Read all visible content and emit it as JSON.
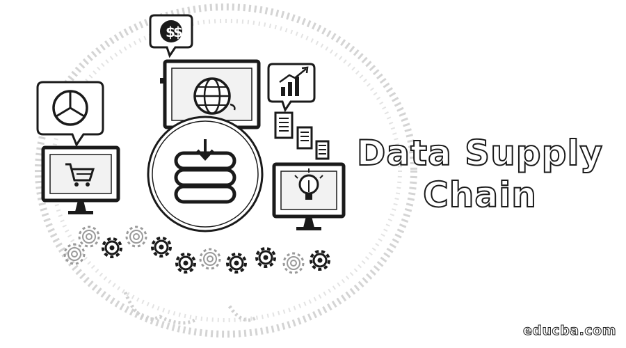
{
  "title": {
    "line1": "Data Supply",
    "line2": "Chain"
  },
  "watermark": "educba.com",
  "icons": [
    "dollar-speech-bubble-icon",
    "globe-monitor-icon",
    "rising-chart-icon",
    "documents-icon",
    "pie-chart-bubble-icon",
    "shopping-cart-monitor-icon",
    "database-download-icon",
    "lightbulb-monitor-icon",
    "gear-chain-icon"
  ],
  "colors": {
    "ink": "#1a1a1a",
    "paper": "#ffffff",
    "halo": "#cfcfcf"
  }
}
